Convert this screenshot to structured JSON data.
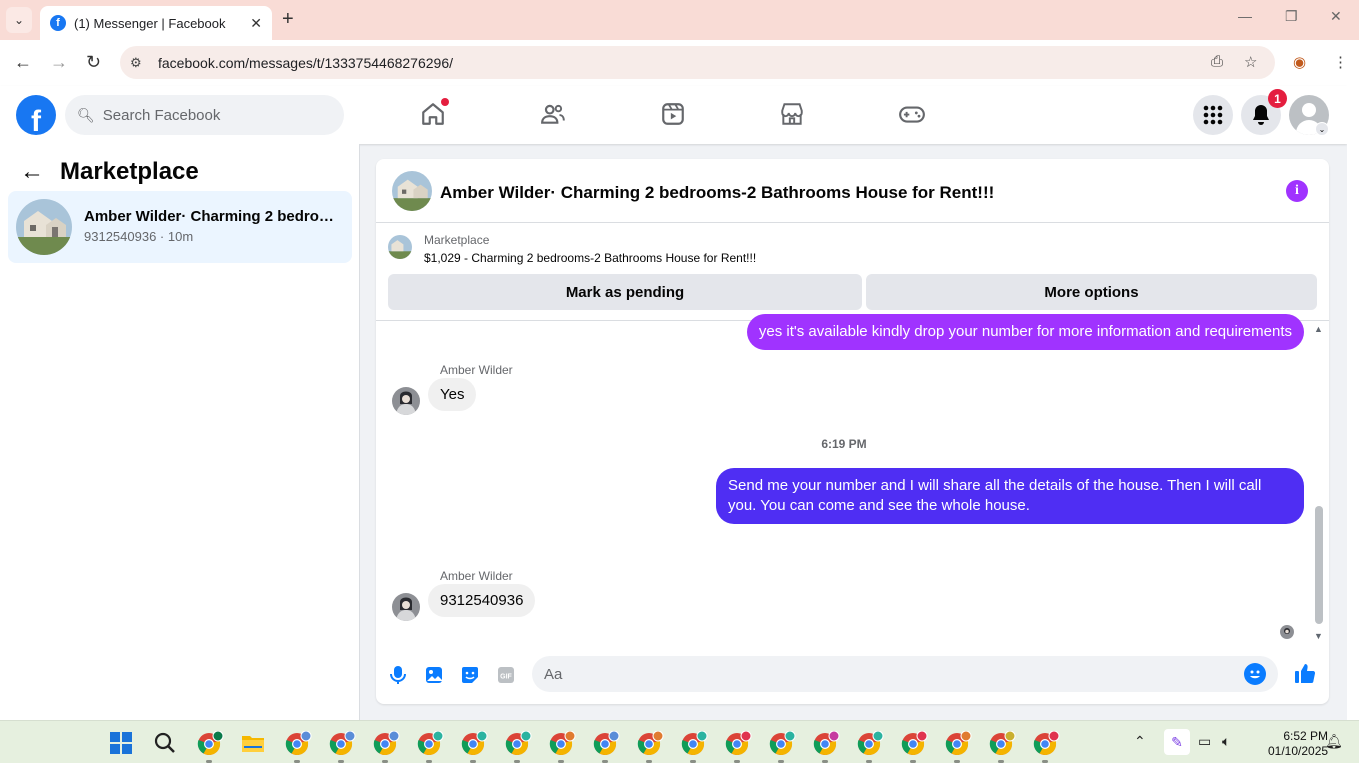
{
  "browser": {
    "tab_title": "(1) Messenger | Facebook",
    "url": "facebook.com/messages/t/1333754468276296/"
  },
  "fb_header": {
    "search_placeholder": "Search Facebook",
    "notifications_count": "1",
    "brand_color": "#1877f2"
  },
  "left_panel": {
    "title": "Marketplace",
    "conversation": {
      "title": "Amber Wilder· Charming 2 bedroo...",
      "subtitle": "9312540936 · 10m"
    }
  },
  "chat": {
    "title": "Amber Wilder· Charming 2 bedrooms-2 Bathrooms House for Rent!!!",
    "listing_label": "Marketplace",
    "listing_title": "$1,029 - Charming 2 bedrooms-2 Bathrooms House for Rent!!!",
    "mark_pending_label": "Mark as pending",
    "more_options_label": "More options",
    "messages": [
      {
        "direction": "out",
        "text": "yes it's available kindly drop your number for more information and requirements",
        "color": "#a033ff"
      },
      {
        "direction": "in",
        "sender": "Amber Wilder",
        "text": "Yes"
      },
      {
        "direction": "timestamp",
        "text": "6:19 PM"
      },
      {
        "direction": "out",
        "text": "Send me your number and I will share all the details of the house. Then I will call you. You can come and see the whole house.",
        "color": "#4f2ef3"
      },
      {
        "direction": "in",
        "sender": "Amber Wilder",
        "text": "9312540936"
      }
    ],
    "composer_placeholder": "Aa",
    "accent_color": "#0a7cff"
  },
  "taskbar": {
    "time": "6:52 PM",
    "date": "01/10/2025"
  }
}
